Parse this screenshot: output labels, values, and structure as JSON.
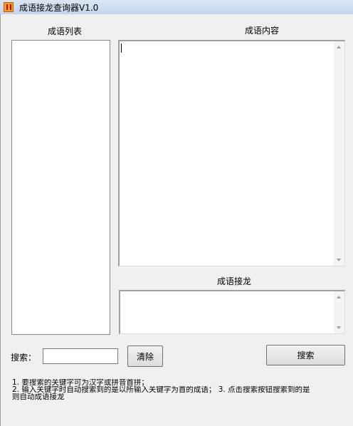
{
  "window": {
    "title": "成语接龙查询器V1.0",
    "icon": "app-icon"
  },
  "idiom_list": {
    "label": "成语列表",
    "items": []
  },
  "idiom_content": {
    "label": "成语内容",
    "value": ""
  },
  "idiom_chain": {
    "label": "成语接龙",
    "value": ""
  },
  "search": {
    "label": "搜索：",
    "value": "",
    "clear_label": "清除",
    "search_label": "搜索"
  },
  "help": {
    "line1": "1. 要搜索的关键字可为汉字或拼音首拼；",
    "line2": "2. 输入关键字时自动搜索到的是以所输入关键字为首的成语； 3. 点击搜索按钮搜索到的是",
    "line3": "则自动成语接龙"
  }
}
